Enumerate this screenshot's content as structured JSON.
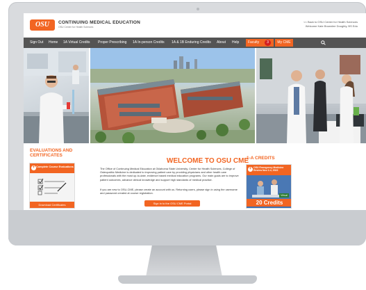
{
  "header": {
    "logo_text": "OSU",
    "title": "CONTINUING MEDICAL EDUCATION",
    "subtitle": "OSU Center for Health Sciences",
    "back_link": "<< Back to OSU Center for Health Sciences",
    "welcome_user": "Welcome Kate Brownlee Doughty, BS Edu"
  },
  "nav": {
    "items": [
      "Sign Out",
      "Home",
      "1A Virtual Credits",
      "Proper Prescribing",
      "1A In-person Credits",
      "1A & 1B Enduring Credits",
      "About",
      "Help"
    ],
    "faculty_label": "Faculty",
    "faculty_count": "3",
    "my_cme_label": "My CME"
  },
  "evaluations": {
    "title": "EVALUATIONS AND CERTIFICATES",
    "card_header": "Complete Course Evaluations",
    "download_label": "Download Certificates"
  },
  "welcome": {
    "title": "WELCOME TO OSU CME",
    "paragraph1": "The Office of Continuing Medical Education at Oklahoma State University, Center for Health Sciences, College of Osteopathic Medicine is dedicated to improving patient care by providing physicians and other health care professionals with the most up-to-date, evidence based medical education programs. Our main goals are to improve patient outcomes, advance clinical knowledge and support high standards of medical practice.",
    "paragraph2": "If you are new to OSU-CME, please create an account with us. Returning users, please sign in using the username and password created at course registration.",
    "button": "Sign in to the OSU CME Portal"
  },
  "credits": {
    "title": "1-A CREDITS",
    "card_header": "OSU Emergency Medicine Review Nov 2-4, 2022",
    "virtual_tag": "Virtual",
    "credits_label": "20 Credits"
  },
  "colors": {
    "accent": "#f26522",
    "nav_bg": "#545454"
  }
}
